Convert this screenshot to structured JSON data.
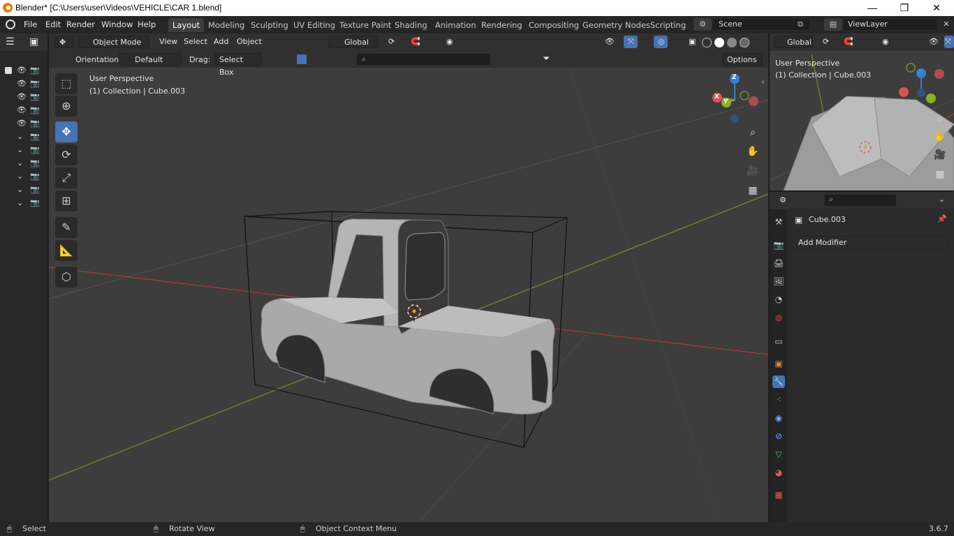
{
  "window": {
    "title": "Blender* [C:\\Users\\user\\Videos\\VEHICLE\\CAR 1.blend]",
    "minimize": "—",
    "maximize": "❐",
    "close": "✕"
  },
  "menus": [
    "File",
    "Edit",
    "Render",
    "Window",
    "Help"
  ],
  "workspaces": [
    "Layout",
    "Modeling",
    "Sculpting",
    "UV Editing",
    "Texture Paint",
    "Shading",
    "Animation",
    "Rendering",
    "Compositing",
    "Geometry Nodes",
    "Scripting"
  ],
  "scene": "Scene",
  "view_layer": "ViewLayer",
  "viewport": {
    "mode": "Object Mode",
    "menu_items": [
      "View",
      "Select",
      "Add",
      "Object"
    ],
    "transform_orientation": "Global",
    "orientation_label": "Orientation:",
    "orientation_value": "Default",
    "drag_label": "Drag:",
    "drag_value": "Select Box",
    "options": "Options",
    "overlay_title": "User Perspective",
    "overlay_collection": "(1) Collection | Cube.003",
    "gizmo_x": "X",
    "gizmo_y": "Y",
    "gizmo_z": "Z"
  },
  "preview": {
    "orientation": "Global",
    "overlay_title": "User Perspective",
    "overlay_collection": "(1) Collection | Cube.003"
  },
  "properties": {
    "object_name": "Cube.003",
    "add_modifier": "Add Modifier"
  },
  "outliner_rows": [
    {
      "eye": "👁",
      "cam": "📷"
    },
    {
      "eye": "👁",
      "cam": "📷"
    },
    {
      "eye": "👁",
      "cam": "📷"
    },
    {
      "eye": "👁",
      "cam": "📷"
    },
    {
      "eye": "👁",
      "cam": "📷"
    },
    {
      "eye": "⌄",
      "cam": "📷"
    },
    {
      "eye": "⌄",
      "cam": "📷"
    },
    {
      "eye": "⌄",
      "cam": "📷"
    },
    {
      "eye": "⌄",
      "cam": "📷"
    },
    {
      "eye": "⌄",
      "cam": "📷"
    }
  ],
  "status": {
    "select": "Select",
    "rotate": "Rotate View",
    "context": "Object Context Menu",
    "version": "3.6.7"
  },
  "colors": {
    "accent": "#4772b3",
    "axis_x": "#d9534f",
    "axis_y": "#8ab12a",
    "axis_z": "#3a7fd5",
    "bg_viewport": "#3d3d3d"
  }
}
